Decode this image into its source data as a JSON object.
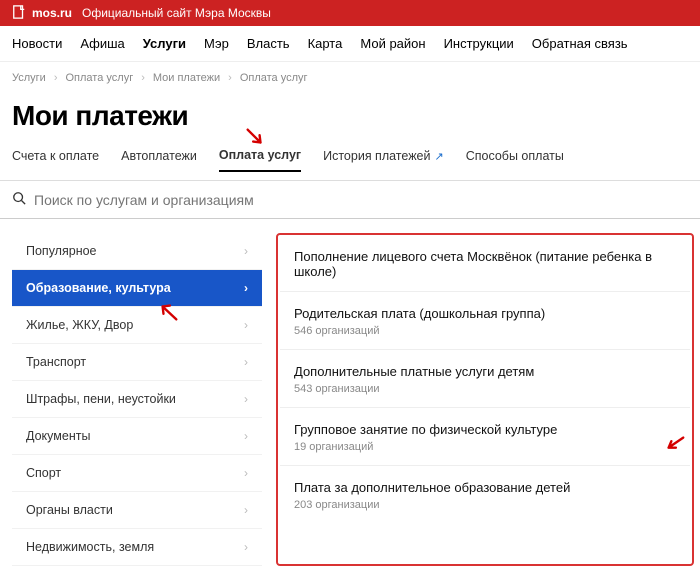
{
  "topbar": {
    "site": "mos.ru",
    "desc": "Официальный сайт Мэра Москвы"
  },
  "mainnav": [
    "Новости",
    "Афиша",
    "Услуги",
    "Мэр",
    "Власть",
    "Карта",
    "Мой район",
    "Инструкции",
    "Обратная связь"
  ],
  "mainnav_active": 2,
  "breadcrumb": [
    "Услуги",
    "Оплата услуг",
    "Мои платежи",
    "Оплата услуг"
  ],
  "page_title": "Мои платежи",
  "tabs": [
    {
      "label": "Счета к оплате",
      "active": false,
      "ext": false
    },
    {
      "label": "Автоплатежи",
      "active": false,
      "ext": false
    },
    {
      "label": "Оплата услуг",
      "active": true,
      "ext": false
    },
    {
      "label": "История платежей",
      "active": false,
      "ext": true
    },
    {
      "label": "Способы оплаты",
      "active": false,
      "ext": false
    }
  ],
  "search": {
    "placeholder": "Поиск по услугам и организациям"
  },
  "sidebar": [
    "Популярное",
    "Образование, культура",
    "Жилье, ЖКУ, Двор",
    "Транспорт",
    "Штрафы, пени, неустойки",
    "Документы",
    "Спорт",
    "Органы власти",
    "Недвижимость, земля"
  ],
  "sidebar_active": 1,
  "results": [
    {
      "title": "Пополнение лицевого счета Москвёнок (питание ребенка в школе)",
      "sub": ""
    },
    {
      "title": "Родительская плата (дошкольная группа)",
      "sub": "546 организаций"
    },
    {
      "title": "Дополнительные платные услуги детям",
      "sub": "543 организации"
    },
    {
      "title": "Групповое занятие по физической культуре",
      "sub": "19 организаций"
    },
    {
      "title": "Плата за дополнительное образование детей",
      "sub": "203 организации"
    }
  ]
}
